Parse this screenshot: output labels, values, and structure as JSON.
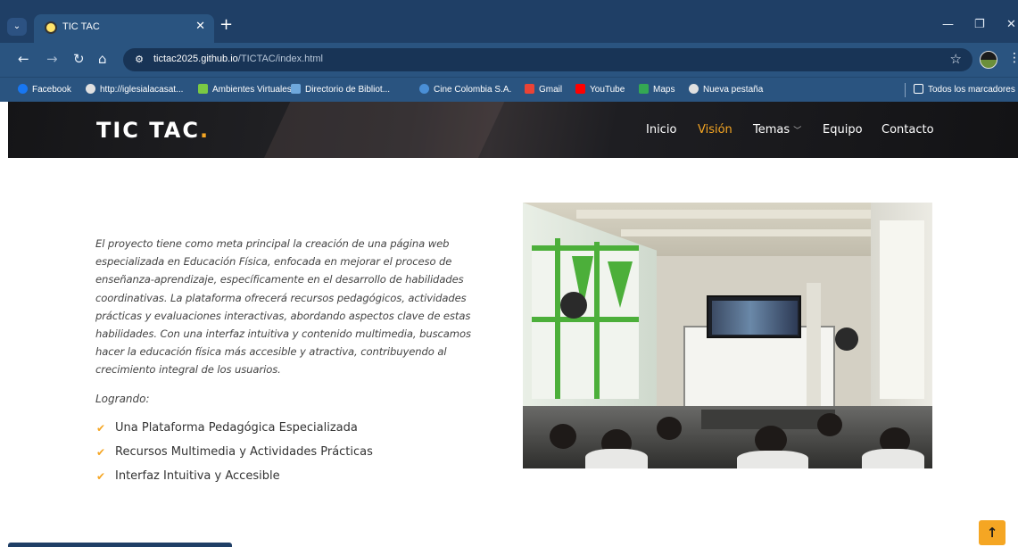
{
  "browser": {
    "tab_title": "TIC TAC",
    "tab_close": "✕",
    "new_tab": "+",
    "url_host": "tictac2025.github.io",
    "url_path": "/TICTAC/index.html",
    "bookmarks": [
      {
        "label": "Facebook",
        "icon_color": "#1877f2"
      },
      {
        "label": "http://iglesialacasat...",
        "icon_color": "#e0e0e0"
      },
      {
        "label": "Ambientes Virtuales",
        "icon_color": "#7ac943"
      },
      {
        "label": "Directorio de Bibliot...",
        "icon_color": "#6fa8dc"
      },
      {
        "label": "Cine Colombia S.A.",
        "icon_color": "#4a8fd6"
      },
      {
        "label": "Gmail",
        "icon_color": "#ea4335"
      },
      {
        "label": "YouTube",
        "icon_color": "#ff0000"
      },
      {
        "label": "Maps",
        "icon_color": "#34a853"
      },
      {
        "label": "Nueva pestaña",
        "icon_color": "#e0e0e0"
      }
    ],
    "all_bookmarks": "Todos los marcadores",
    "icons": {
      "back": "back-arrow-icon",
      "forward": "forward-arrow-icon",
      "reload": "reload-icon",
      "home": "home-icon",
      "star": "star-icon",
      "folder": "folder-icon"
    }
  },
  "site": {
    "logo_text": "TIC TAC",
    "logo_dot": ".",
    "accent_color": "#f5a623",
    "nav": [
      {
        "label": "Inicio",
        "active": false
      },
      {
        "label": "Visión",
        "active": true
      },
      {
        "label": "Temas",
        "has_dropdown": true
      },
      {
        "label": "Equipo",
        "active": false
      },
      {
        "label": "Contacto",
        "active": false
      }
    ]
  },
  "content": {
    "intro_lines": [
      "El proyecto tiene como meta principal la creación de una página web",
      "especializada en Educación Física, enfocada en mejorar el proceso de",
      "enseñanza-aprendizaje, específicamente en el desarrollo de habilidades",
      "coordinativas. La plataforma ofrecerá recursos pedagógicos, actividades",
      "prácticas y evaluaciones interactivas, abordando aspectos clave de estas",
      "habilidades. Con una interfaz intuitiva y contenido multimedia, buscamos",
      "hacer la educación física más accesible y atractiva, contribuyendo al",
      "crecimiento integral de los usuarios."
    ],
    "logrando": "Logrando:",
    "features": [
      "Una Plataforma Pedagógica Especializada",
      "Recursos Multimedia y Actividades Prácticas",
      "Interfaz Intuitiva y Accesible"
    ],
    "check_glyph": "✔"
  },
  "scroll_top_glyph": "↑"
}
